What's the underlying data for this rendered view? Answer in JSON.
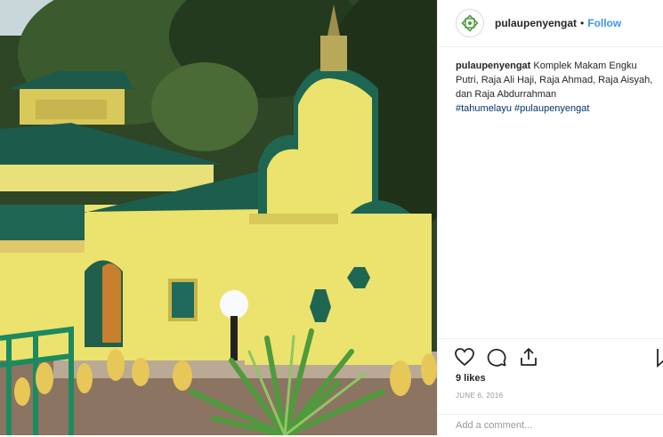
{
  "post": {
    "username": "pulaupenyengat",
    "separator": "•",
    "follow_label": "Follow",
    "caption_text": " Komplek Makam Engku Putri, Raja Ali Haji, Raja Ahmad, Raja Aisyah, dan Raja Abdurrahman",
    "hashtags": "#tahumelayu #pulaupenyengat",
    "likes": "9 likes",
    "date": "JUNE 6, 2016",
    "comment_placeholder": "Add a comment..."
  },
  "icons": {
    "avatar": "green-geometric-logo-icon",
    "like": "heart-icon",
    "comment": "comment-bubble-icon",
    "share": "share-upload-icon",
    "save": "bookmark-icon"
  },
  "colors": {
    "link": "#3897f0",
    "hashtag": "#003569",
    "border": "#efefef",
    "muted": "#999999"
  }
}
